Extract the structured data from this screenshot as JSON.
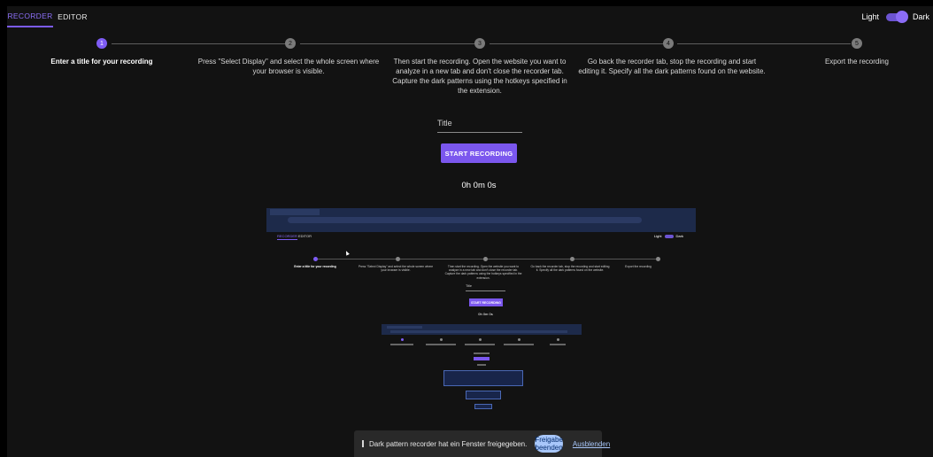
{
  "tabs": {
    "recorder": "RECORDER",
    "editor": "EDITOR"
  },
  "theme": {
    "light_label": "Light",
    "dark_label": "Dark",
    "mode": "dark"
  },
  "steps": [
    {
      "number": "1",
      "label": "Enter a title for your recording",
      "active": true
    },
    {
      "number": "2",
      "label": "Press \"Select Display\" and select the whole screen where your browser is visible.",
      "active": false
    },
    {
      "number": "3",
      "label": "Then start the recording. Open the website you want to analyze in a new tab and don't close the recorder tab. Capture the dark patterns using the hotkeys specified in the extension.",
      "active": false
    },
    {
      "number": "4",
      "label": "Go back the recorder tab, stop the recording and start editing it. Specify all the dark patterns found on the website.",
      "active": false
    },
    {
      "number": "5",
      "label": "Export the recording",
      "active": false
    }
  ],
  "form": {
    "title_placeholder": "Title",
    "start_button": "START RECORDING",
    "timer": "0h 0m 0s"
  },
  "screen_share_bar": {
    "message": "Dark pattern recorder hat ein Fenster freigegeben.",
    "stop_button": "Freigabe beenden",
    "hide_link": "Ausblenden"
  },
  "colors": {
    "accent": "#7b57ee",
    "background": "#121212",
    "share_button": "#a8c7fa"
  }
}
